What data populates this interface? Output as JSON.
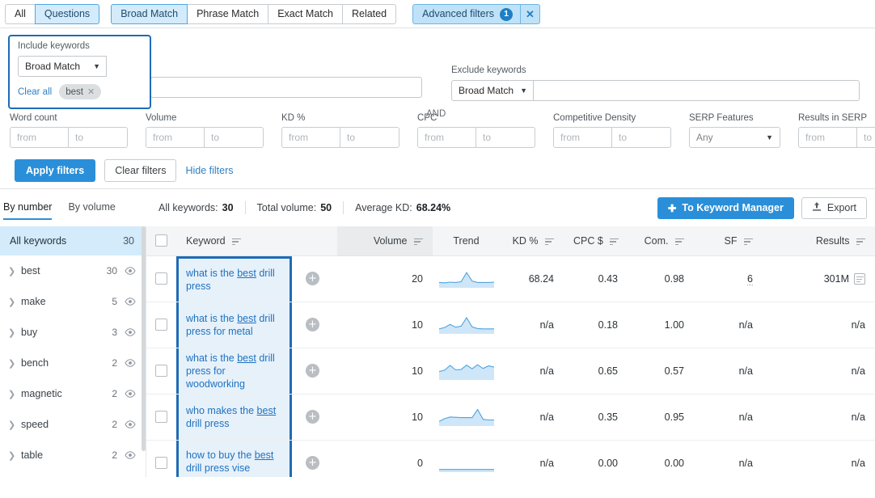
{
  "tabs": {
    "group1": [
      {
        "label": "All",
        "active": false
      },
      {
        "label": "Questions",
        "active": true
      }
    ],
    "group2": [
      {
        "label": "Broad Match",
        "active": true
      },
      {
        "label": "Phrase Match",
        "active": false
      },
      {
        "label": "Exact Match",
        "active": false
      },
      {
        "label": "Related",
        "active": false
      }
    ],
    "advanced": {
      "label": "Advanced filters",
      "badge": "1",
      "close": "✕"
    }
  },
  "filters": {
    "include": {
      "label": "Include keywords",
      "match": "Broad Match",
      "input_value": "",
      "input_placeholder": "",
      "clear_all": "Clear all",
      "chips": [
        {
          "label": "best",
          "remove": "✕"
        }
      ]
    },
    "and_label": "AND",
    "exclude": {
      "label": "Exclude keywords",
      "match": "Broad Match",
      "input_value": "",
      "input_placeholder": ""
    },
    "metrics": [
      {
        "label": "Word count",
        "type": "range",
        "from": "from",
        "to": "to"
      },
      {
        "label": "Volume",
        "type": "range",
        "from": "from",
        "to": "to"
      },
      {
        "label": "KD %",
        "type": "range",
        "from": "from",
        "to": "to"
      },
      {
        "label": "CPC",
        "type": "range",
        "from": "from",
        "to": "to"
      },
      {
        "label": "Competitive Density",
        "type": "range",
        "from": "from",
        "to": "to"
      },
      {
        "label": "SERP Features",
        "type": "select",
        "value": "Any"
      },
      {
        "label": "Results in SERP",
        "type": "range",
        "from": "from",
        "to": "to"
      }
    ],
    "remove_row": "✕",
    "apply_label": "Apply filters",
    "clear_label": "Clear filters",
    "hide_label": "Hide filters"
  },
  "summary": {
    "view_tabs": [
      {
        "label": "By number",
        "active": true
      },
      {
        "label": "By volume",
        "active": false
      }
    ],
    "stats": [
      {
        "label": "All keywords:",
        "value": "30"
      },
      {
        "label": "Total volume:",
        "value": "50"
      },
      {
        "label": "Average KD:",
        "value": "68.24%"
      }
    ],
    "keyword_manager_label": "To Keyword Manager",
    "keyword_manager_icon": "plus-icon",
    "export_label": "Export",
    "export_icon": "upload-icon"
  },
  "sidebar": {
    "all": {
      "label": "All keywords",
      "count": "30"
    },
    "items": [
      {
        "label": "best",
        "count": "30"
      },
      {
        "label": "make",
        "count": "5"
      },
      {
        "label": "buy",
        "count": "3"
      },
      {
        "label": "bench",
        "count": "2"
      },
      {
        "label": "magnetic",
        "count": "2"
      },
      {
        "label": "speed",
        "count": "2"
      },
      {
        "label": "table",
        "count": "2"
      }
    ]
  },
  "table": {
    "columns": [
      {
        "key": "check",
        "label": "",
        "sortable": false
      },
      {
        "key": "keyword",
        "label": "Keyword",
        "sortable": true
      },
      {
        "key": "volume",
        "label": "Volume",
        "sortable": true
      },
      {
        "key": "trend",
        "label": "Trend",
        "sortable": false
      },
      {
        "key": "kd",
        "label": "KD %",
        "sortable": true
      },
      {
        "key": "cpc",
        "label": "CPC $",
        "sortable": true
      },
      {
        "key": "com",
        "label": "Com.",
        "sortable": true
      },
      {
        "key": "sf",
        "label": "SF",
        "sortable": true
      },
      {
        "key": "results",
        "label": "Results",
        "sortable": true
      }
    ],
    "rows": [
      {
        "keyword_pre": "what is the ",
        "keyword_hl": "best",
        "keyword_post": " drill press",
        "volume": "20",
        "trend": [
          0.22,
          0.2,
          0.24,
          0.22,
          0.26,
          0.8,
          0.3,
          0.22,
          0.22,
          0.22,
          0.24
        ],
        "kd": "68.24",
        "cpc": "0.43",
        "com": "0.98",
        "sf": "6",
        "results": "301M",
        "has_serp_icon": true
      },
      {
        "keyword_pre": "what is the ",
        "keyword_hl": "best",
        "keyword_post": " drill press for metal",
        "volume": "10",
        "trend": [
          0.2,
          0.28,
          0.46,
          0.3,
          0.36,
          0.86,
          0.32,
          0.22,
          0.2,
          0.2,
          0.2
        ],
        "kd": "n/a",
        "cpc": "0.18",
        "com": "1.00",
        "sf": "n/a",
        "results": "n/a",
        "has_serp_icon": false
      },
      {
        "keyword_pre": "what is the ",
        "keyword_hl": "best",
        "keyword_post": " drill press for woodworking",
        "volume": "10",
        "trend": [
          0.4,
          0.48,
          0.76,
          0.5,
          0.52,
          0.78,
          0.56,
          0.8,
          0.58,
          0.74,
          0.66
        ],
        "kd": "n/a",
        "cpc": "0.65",
        "com": "0.57",
        "sf": "n/a",
        "results": "n/a",
        "has_serp_icon": false
      },
      {
        "keyword_pre": "who makes the ",
        "keyword_hl": "best",
        "keyword_post": " drill press",
        "volume": "10",
        "trend": [
          0.18,
          0.34,
          0.44,
          0.42,
          0.4,
          0.4,
          0.4,
          0.88,
          0.3,
          0.26,
          0.26
        ],
        "kd": "n/a",
        "cpc": "0.35",
        "com": "0.95",
        "sf": "n/a",
        "results": "n/a",
        "has_serp_icon": false
      },
      {
        "keyword_pre": "how to buy the ",
        "keyword_hl": "best",
        "keyword_post": " drill press vise",
        "volume": "0",
        "trend": [
          0.06,
          0.06,
          0.06,
          0.06,
          0.06,
          0.06,
          0.06,
          0.06,
          0.06,
          0.06,
          0.06
        ],
        "kd": "n/a",
        "cpc": "0.00",
        "com": "0.00",
        "sf": "n/a",
        "results": "n/a",
        "has_serp_icon": false
      }
    ]
  },
  "colors": {
    "accent": "#2a8fd8",
    "highlight_border": "#1f6bb5",
    "highlight_bg": "#e7f1fa",
    "tab_active_bg": "#d3ebfb",
    "danger": "#e03e3e",
    "link": "#2f7fc4"
  }
}
